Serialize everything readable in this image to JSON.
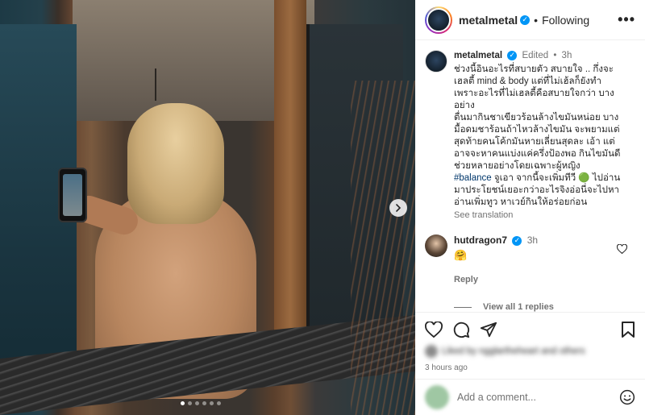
{
  "post": {
    "username": "metalmetal",
    "follow_status": "Following",
    "separator": "•",
    "more_label": "•••"
  },
  "caption": {
    "username": "metalmetal",
    "edited_label": "Edited",
    "time": "3h",
    "lines": [
      "ช่วงนี้อินอะไรที่สบายตัว สบายใจ .. กึ่งจะ",
      "เฮลตี้ mind & body แต่ที่ไม่เฮ้ลก็ยังทำ",
      "เพราะอะไรที่ไม่เฮลตี้คือสบายใจกว่า บาง",
      "อย่าง",
      "ตื่นมากินชาเขียวร้อนล้างไขมันหน่อย บาง",
      "มื้อดมชาร้อนถ้าไหวล้างไขมัน จะพยามแต่",
      "สุดท้ายคนโค้กมันหายเลี่ยนสุดละ เอ้า แต่",
      "อาจจะหาคนแบ่งแค่ครึ่งป้องพอ กินไขมันดี",
      "ช่วยหลายอย่างโดยเฉพาะผู้หญิง"
    ],
    "hashtag": "#balance",
    "tail_lines": [
      " จูเอา จากนี้จะเพิ่มทีวี 🟢 ไปอ่าน",
      "มาประโยชน์เยอะกว่าอะไรจิงอ่อนี่จะไปหา",
      "อ่านเพิ่มทูว หาเวย์กินให้อร่อยก่อน"
    ],
    "see_translation": "See translation"
  },
  "comment": {
    "username": "hutdragon7",
    "time": "3h",
    "text": "🤗",
    "reply_label": "Reply",
    "view_replies": "View all 1 replies"
  },
  "engagement": {
    "liked_by_text": "Liked by ngglartheheart and others",
    "time_ago": "3 hours ago"
  },
  "composer": {
    "placeholder": "Add a comment..."
  },
  "carousel": {
    "dot_count": 6,
    "active_index": 0
  },
  "colors": {
    "verified_blue": "#0095f6",
    "hashtag_blue": "#00376b",
    "muted_text": "#737373"
  }
}
